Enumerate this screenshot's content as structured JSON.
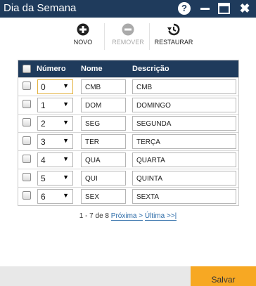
{
  "window": {
    "title": "Dia da Semana",
    "help_label": "?",
    "close_glyph": "✖"
  },
  "toolbar": {
    "novo_label": "NOVO",
    "remover_label": "REMOVER",
    "restaurar_label": "RESTAURAR"
  },
  "table": {
    "columns": [
      "Número",
      "Nome",
      "Descrição"
    ],
    "rows": [
      {
        "numero": "0",
        "nome": "CMB",
        "descricao": "CMB"
      },
      {
        "numero": "1",
        "nome": "DOM",
        "descricao": "DOMINGO"
      },
      {
        "numero": "2",
        "nome": "SEG",
        "descricao": "SEGUNDA"
      },
      {
        "numero": "3",
        "nome": "TER",
        "descricao": "TERÇA"
      },
      {
        "numero": "4",
        "nome": "QUA",
        "descricao": "QUARTA"
      },
      {
        "numero": "5",
        "nome": "QUI",
        "descricao": "QUINTA"
      },
      {
        "numero": "6",
        "nome": "SEX",
        "descricao": "SEXTA"
      }
    ]
  },
  "pager": {
    "range": "1 - 7 de 8",
    "next": "Próxima >",
    "last": "Última >>|"
  },
  "footer": {
    "save_label": "Salvar"
  },
  "colors": {
    "titlebar": "#1f3b5c",
    "accent": "#f7a823",
    "link": "#2a6aa7"
  }
}
